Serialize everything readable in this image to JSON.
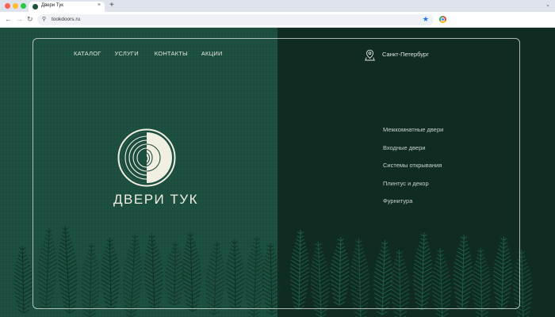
{
  "browser": {
    "tab_title": "Двери Тук",
    "tab_close_icon": "close-icon",
    "new_tab_icon": "plus-icon",
    "url": "tookdoors.ru"
  },
  "site": {
    "nav": [
      "КАТАЛОГ",
      "УСЛУГИ",
      "КОНТАКТЫ",
      "АКЦИИ"
    ],
    "city": "Санкт-Петербург",
    "brand": "ДВЕРИ ТУК",
    "menu": [
      "Межкомнатные двери",
      "Входные двери",
      "Системы открывания",
      "Плинтус и декор",
      "Фурнитура"
    ]
  },
  "colors": {
    "left_panel": "#1c4e3f",
    "right_panel": "#102b22",
    "text": "#e3e7e2",
    "logo": "#f1eee2"
  }
}
